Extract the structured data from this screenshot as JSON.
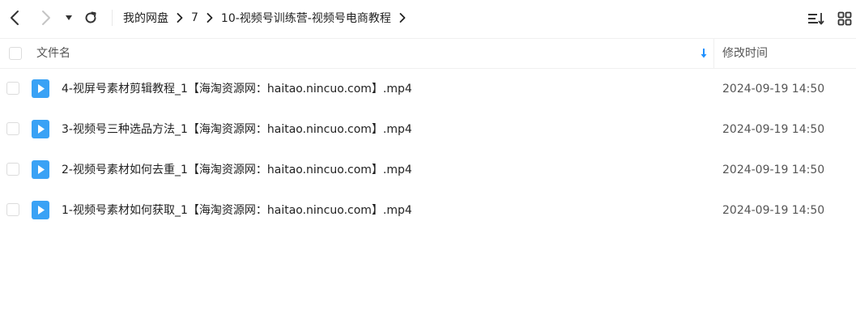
{
  "breadcrumb": [
    "我的网盘",
    "7",
    "10-视频号训练营-视频号电商教程"
  ],
  "header": {
    "name_label": "文件名",
    "time_label": "修改时间"
  },
  "files": [
    {
      "name": "4-视屏号素材剪辑教程_1【海淘资源网：haitao.nincuo.com】.mp4",
      "time": "2024-09-19 14:50",
      "icon": "video-file-icon"
    },
    {
      "name": "3-视频号三种选品方法_1【海淘资源网：haitao.nincuo.com】.mp4",
      "time": "2024-09-19 14:50",
      "icon": "video-file-icon"
    },
    {
      "name": "2-视频号素材如何去重_1【海淘资源网：haitao.nincuo.com】.mp4",
      "time": "2024-09-19 14:50",
      "icon": "video-file-icon"
    },
    {
      "name": "1-视频号素材如何获取_1【海淘资源网：haitao.nincuo.com】.mp4",
      "time": "2024-09-19 14:50",
      "icon": "video-file-icon"
    }
  ],
  "colors": {
    "accent": "#1e90ff",
    "video_icon": "#3aa2f5"
  },
  "icons": {
    "back": "chevron-left-icon",
    "forward": "chevron-right-icon",
    "dropdown": "caret-down-icon",
    "refresh": "refresh-icon",
    "sort": "sort-list-icon",
    "grid": "grid-view-icon",
    "sort_direction": "arrow-down-icon"
  }
}
